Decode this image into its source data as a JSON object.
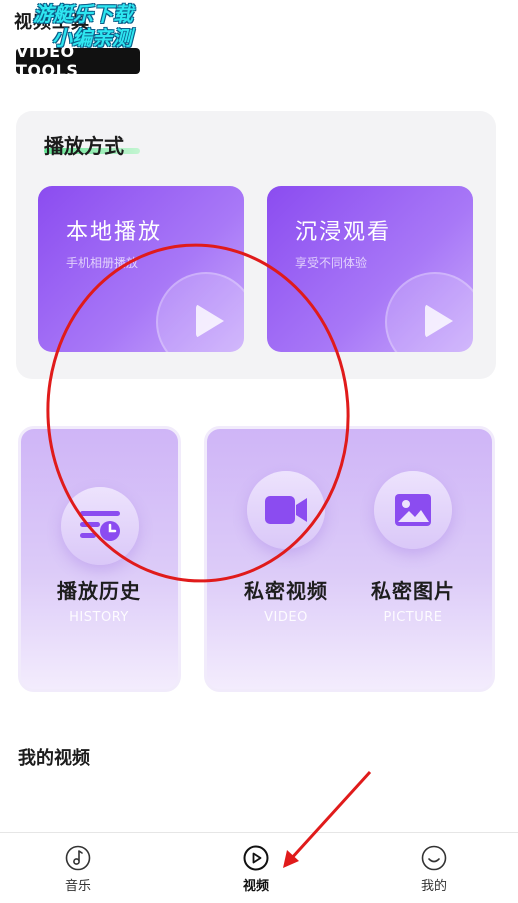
{
  "header": {
    "logo_text": "视频工具",
    "logo_badge": "VIDEO TOOLS",
    "watermark_line1": "游艇乐下载",
    "watermark_line2": "小编亲测"
  },
  "play_mode": {
    "title": "播放方式",
    "cards": [
      {
        "title": "本地播放",
        "subtitle": "手机相册播放",
        "icon": "play-icon"
      },
      {
        "title": "沉浸观看",
        "subtitle": "享受不同体验",
        "icon": "play-icon"
      }
    ]
  },
  "features": [
    {
      "label": "播放历史",
      "sub": "HISTORY",
      "icon": "history-icon"
    },
    {
      "label": "私密视频",
      "sub": "VIDEO",
      "icon": "video-camera-icon"
    },
    {
      "label": "私密图片",
      "sub": "PICTURE",
      "icon": "image-icon"
    }
  ],
  "my_videos": {
    "title": "我的视频"
  },
  "tabbar": {
    "items": [
      {
        "label": "音乐",
        "icon": "music-icon",
        "active": false
      },
      {
        "label": "视频",
        "icon": "play-circle-icon",
        "active": true
      },
      {
        "label": "我的",
        "icon": "smile-icon",
        "active": false
      }
    ]
  },
  "colors": {
    "accent": "#8b4cf0",
    "card_light": "#cfb5f7",
    "annotation": "#e01b1b"
  }
}
